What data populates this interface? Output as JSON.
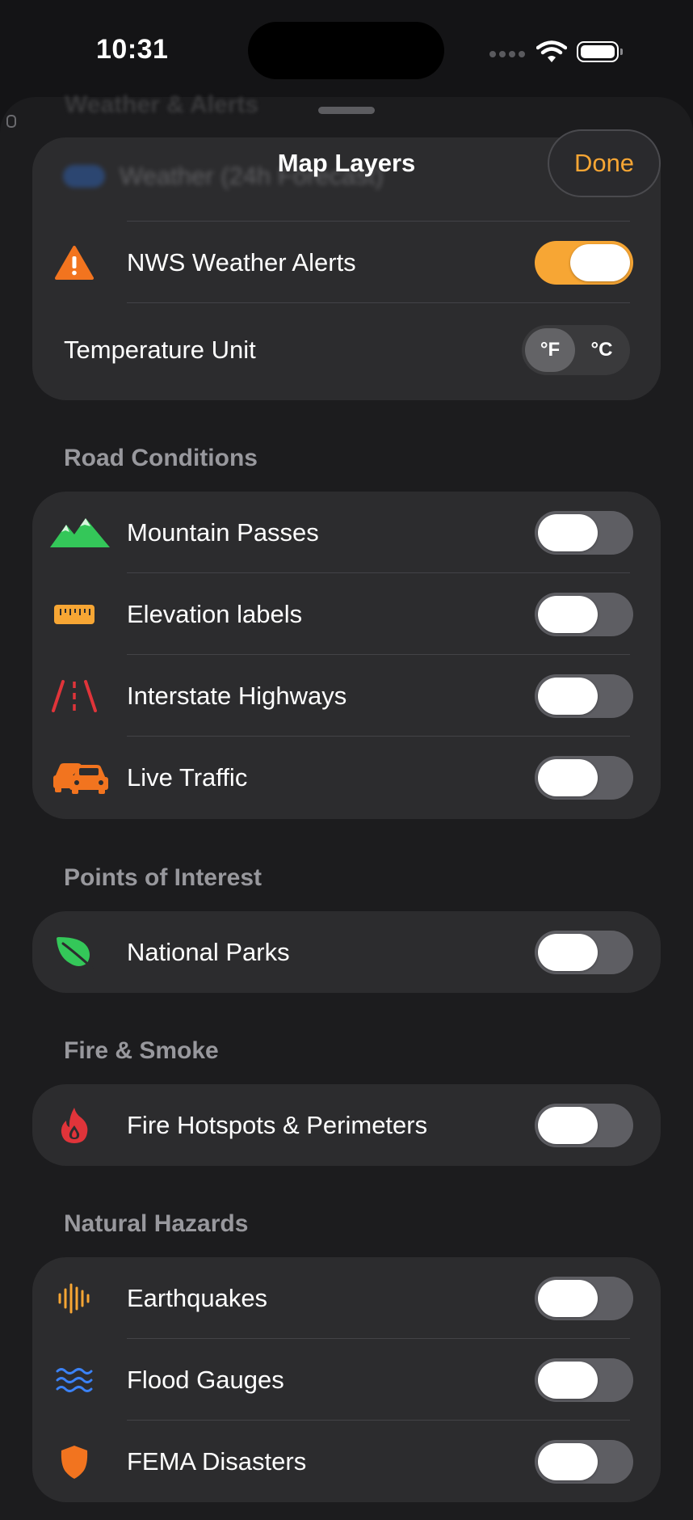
{
  "status_bar": {
    "time": "10:31"
  },
  "sheet": {
    "title": "Map Layers",
    "done_label": "Done",
    "ghost_header": "Weather & Alerts",
    "ghost_row_label": "Weather (24h Forecast)"
  },
  "weather": {
    "alerts_label": "NWS Weather Alerts",
    "alerts_on": true,
    "temp_label": "Temperature Unit",
    "temp_options": [
      "°F",
      "°C"
    ],
    "temp_selected": "°F"
  },
  "road": {
    "title": "Road Conditions",
    "items": [
      {
        "label": "Mountain Passes",
        "icon": "mountain-icon",
        "on": false
      },
      {
        "label": "Elevation labels",
        "icon": "ruler-icon",
        "on": false
      },
      {
        "label": "Interstate Highways",
        "icon": "road-icon",
        "on": false
      },
      {
        "label": "Live Traffic",
        "icon": "cars-icon",
        "on": false
      }
    ]
  },
  "poi": {
    "title": "Points of Interest",
    "items": [
      {
        "label": "National Parks",
        "icon": "leaf-icon",
        "on": false
      }
    ]
  },
  "fire": {
    "title": "Fire & Smoke",
    "items": [
      {
        "label": "Fire Hotspots & Perimeters",
        "icon": "flame-icon",
        "on": false
      }
    ]
  },
  "hazards": {
    "title": "Natural Hazards",
    "items": [
      {
        "label": "Earthquakes",
        "icon": "waveform-icon",
        "on": false
      },
      {
        "label": "Flood Gauges",
        "icon": "water-waves-icon",
        "on": false
      },
      {
        "label": "FEMA Disasters",
        "icon": "shield-icon",
        "on": false
      }
    ]
  },
  "colors": {
    "accent": "#f7a634",
    "background": "#1c1c1e",
    "card": "#2c2c2e"
  }
}
